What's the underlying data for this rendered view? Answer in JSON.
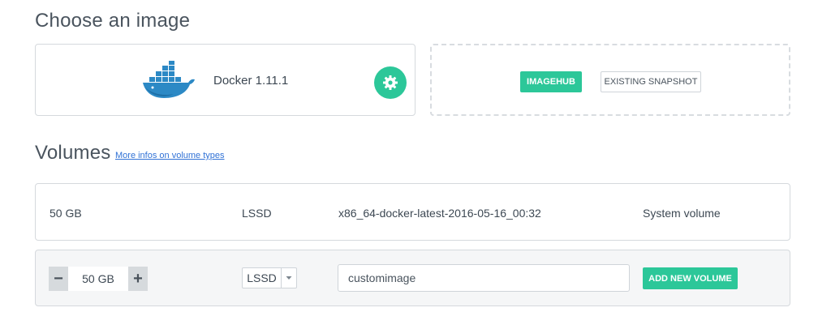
{
  "image_section": {
    "title": "Choose an image",
    "selected_image": {
      "name": "Docker 1.11.1",
      "logo_icon": "docker-whale-icon",
      "settings_icon": "gear-icon"
    },
    "source_buttons": {
      "imagehub": "IMAGEHUB",
      "existing_snapshot": "EXISTING SNAPSHOT"
    }
  },
  "volumes_section": {
    "title": "Volumes",
    "info_link": "More infos on volume types",
    "system_volume": {
      "size": "50 GB",
      "type": "LSSD",
      "image": "x86_64-docker-latest-2016-05-16_00:32",
      "label": "System volume"
    },
    "new_volume": {
      "decrement": "−",
      "size": "50 GB",
      "increment": "+",
      "type": "LSSD",
      "name_value": "customimage",
      "add_button": "ADD NEW VOLUME"
    }
  },
  "colors": {
    "accent": "#2cc799",
    "link": "#3172d6",
    "border": "#d5d9dd"
  }
}
